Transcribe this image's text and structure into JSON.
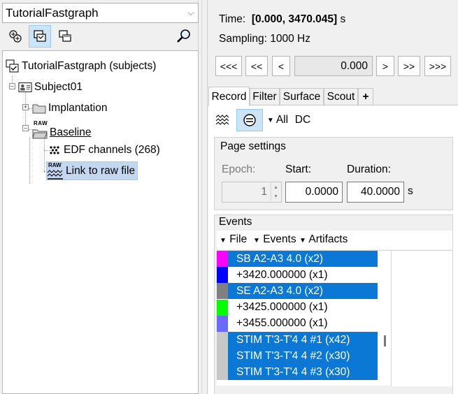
{
  "left_panel": {
    "protocol_select": "TutorialFastgraph",
    "toolbar": [
      "functional-view-icon",
      "anatomy-view-icon",
      "database-view-icon",
      "search-icon"
    ],
    "tree": {
      "root": "TutorialFastgraph (subjects)",
      "subject": "Subject01",
      "folder1": "Implantation",
      "folder2": "Baseline",
      "raw_badge": "RAW",
      "channels": "EDF channels (268)",
      "link": "Link to raw file"
    }
  },
  "right_panel": {
    "time_label": "Time:",
    "time_range": "[0.000, 3470.045]",
    "time_unit": "s",
    "sampling": "Sampling: 1000 Hz",
    "nav": {
      "first": "<<<",
      "prev_page": "<<",
      "prev": "<",
      "current_time": "0.000",
      "next": ">",
      "next_page": ">>",
      "last": ">>>"
    },
    "tabs": [
      "Record",
      "Filter",
      "Surface",
      "Scout",
      "+"
    ],
    "record_toolbar": {
      "montage": "All",
      "dc": "DC"
    },
    "page_settings": {
      "title": "Page settings",
      "epoch_label": "Epoch:",
      "epoch_value": "1",
      "start_label": "Start:",
      "start_value": "0.0000",
      "duration_label": "Duration:",
      "duration_value": "40.0000",
      "unit": "s"
    },
    "events": {
      "title": "Events",
      "menus": [
        "File",
        "Events",
        "Artifacts"
      ],
      "list": [
        {
          "label": "SB A2-A3 4.0  (x2)",
          "color": "#ff00ff",
          "selected": true
        },
        {
          "label": "+3420.000000  (x1)",
          "color": "#0000ff",
          "selected": false
        },
        {
          "label": "SE A2-A3 4.0  (x2)",
          "color": "#808080",
          "selected": true
        },
        {
          "label": "+3425.000000  (x1)",
          "color": "#00ff00",
          "selected": false
        },
        {
          "label": "+3455.000000  (x1)",
          "color": "#6a6aff",
          "selected": false
        },
        {
          "label": "STIM T'3-T'4 4 #1  (x42)",
          "color": "#c8c8c8",
          "selected": true
        },
        {
          "label": "STIM T'3-T'4 4 #2  (x30)",
          "color": "#c8c8c8",
          "selected": true
        },
        {
          "label": "STIM T'3-T'4 4 #3  (x30)",
          "color": "#c8c8c8",
          "selected": true
        }
      ]
    }
  }
}
